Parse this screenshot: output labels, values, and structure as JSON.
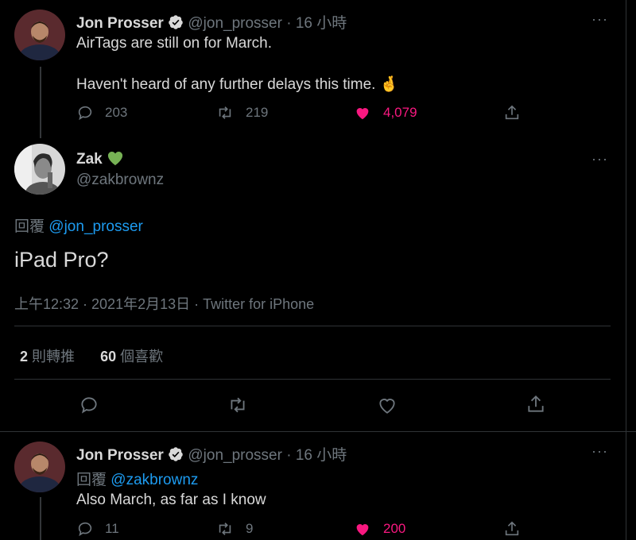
{
  "tweet1": {
    "display_name": "Jon Prosser",
    "handle": "@jon_prosser",
    "separator": "·",
    "time": "16 小時",
    "line1": "AirTags are still on for March.",
    "line2": "Haven't heard of any further delays this time. 🤞",
    "replies": "203",
    "retweets": "219",
    "likes": "4,079"
  },
  "main_tweet": {
    "display_name": "Zak",
    "name_emoji": "💚",
    "handle": "@zakbrownz",
    "reply_prefix": "回覆",
    "reply_to": "@jon_prosser",
    "text": "iPad Pro?",
    "timestamp": "上午12:32 · 2021年2月13日 · Twitter for iPhone",
    "retweet_count": "2",
    "retweet_label": "則轉推",
    "like_count": "60",
    "like_label": "個喜歡"
  },
  "tweet3": {
    "display_name": "Jon Prosser",
    "handle": "@jon_prosser",
    "separator": "·",
    "time": "16 小時",
    "reply_prefix": "回覆",
    "reply_to": "@zakbrownz",
    "text": "Also March, as far as I know",
    "replies": "11",
    "retweets": "9",
    "likes": "200"
  },
  "more_label": "···",
  "colors": {
    "background": "#000000",
    "text": "#d9d9d9",
    "muted": "#6e767d",
    "link": "#1d9bf0",
    "like_red": "#f91880",
    "verified": "#d9d9d9",
    "divider": "#2f3336"
  },
  "icons": [
    "reply-icon",
    "retweet-icon",
    "like-icon",
    "share-icon",
    "verified-icon",
    "more-icon"
  ]
}
